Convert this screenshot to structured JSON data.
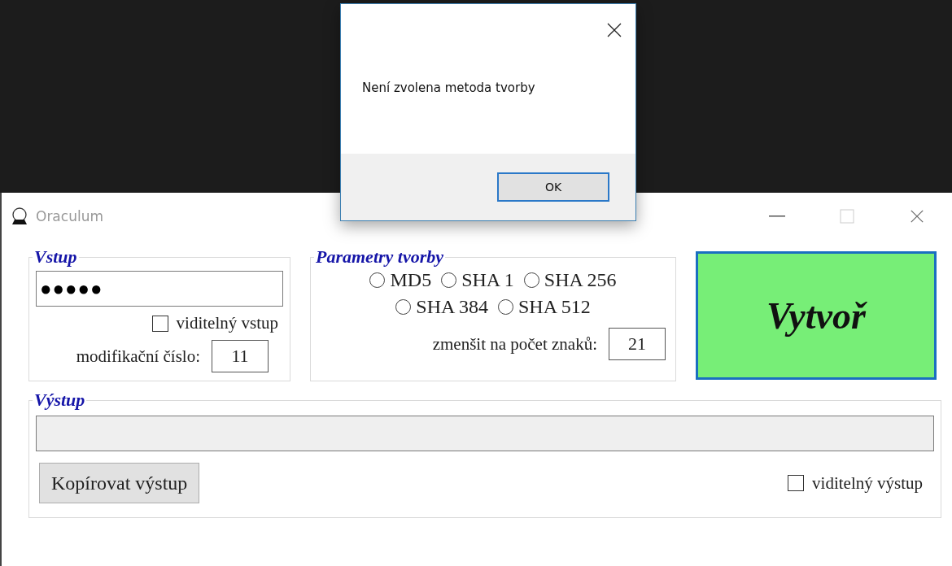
{
  "dialog": {
    "message": "Není zvolena metoda tvorby",
    "buttons": [
      {
        "label": "OK",
        "default": true
      }
    ]
  },
  "window": {
    "title": "Oraculum"
  },
  "input_group": {
    "legend": "Vstup",
    "masked_value": "●●●●●",
    "visible_checkbox": {
      "label": "viditelný vstup",
      "checked": false
    },
    "modifier": {
      "label": "modifikační číslo:",
      "value": "11"
    }
  },
  "params_group": {
    "legend": "Parametry tvorby",
    "methods": [
      {
        "label": "MD5",
        "selected": false
      },
      {
        "label": "SHA 1",
        "selected": false
      },
      {
        "label": "SHA 256",
        "selected": false
      },
      {
        "label": "SHA 384",
        "selected": false
      },
      {
        "label": "SHA 512",
        "selected": false
      }
    ],
    "length": {
      "label": "zmenšit na počet znaků:",
      "value": "21"
    }
  },
  "create_button": {
    "label": "Vytvoř"
  },
  "output_group": {
    "legend": "Výstup",
    "copy_button": {
      "label": "Kopírovat výstup"
    },
    "visible_checkbox": {
      "label": "viditelný výstup",
      "checked": false
    }
  }
}
